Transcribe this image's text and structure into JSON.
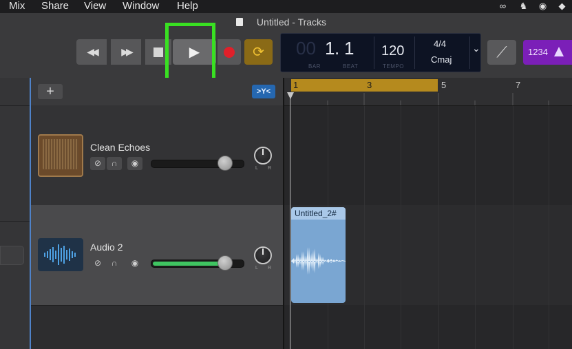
{
  "menu": {
    "items": [
      "Mix",
      "Share",
      "View",
      "Window",
      "Help"
    ]
  },
  "toolbar": {
    "window_title": "Untitled - Tracks",
    "rewind_glyph": "◀◀",
    "forward_glyph": "▶▶",
    "play_glyph": "▶",
    "cycle_glyph": "⟳",
    "tuner_glyph": "⟋",
    "count_in_label": "1234",
    "highlight_color": "#39e022"
  },
  "lcd": {
    "bar_value": "1",
    "bar_dim_prefix": "00",
    "beat_value": "1",
    "bar_label": "BAR",
    "beat_label": "BEAT",
    "tempo_value": "120",
    "tempo_label": "TEMPO",
    "time_signature": "4/4",
    "key": "Cmaj",
    "dropdown_glyph": "⌄"
  },
  "track_list": {
    "add_glyph": "+",
    "filter_glyph": ">Y<"
  },
  "tracks": [
    {
      "name": "Clean Echoes",
      "icon": "guitar-amp-icon",
      "volume": 0.8,
      "buttons": [
        "mute",
        "headphones",
        "record-enable"
      ]
    },
    {
      "name": "Audio 2",
      "icon": "waveform-icon",
      "volume": 0.8,
      "buttons": [
        "mute",
        "headphones",
        "record-enable"
      ]
    }
  ],
  "ruler": {
    "bars": [
      "1",
      "3",
      "5",
      "7"
    ]
  },
  "region": {
    "title": "Untitled_2#"
  },
  "pan_labels": {
    "left": "L",
    "right": "R"
  }
}
